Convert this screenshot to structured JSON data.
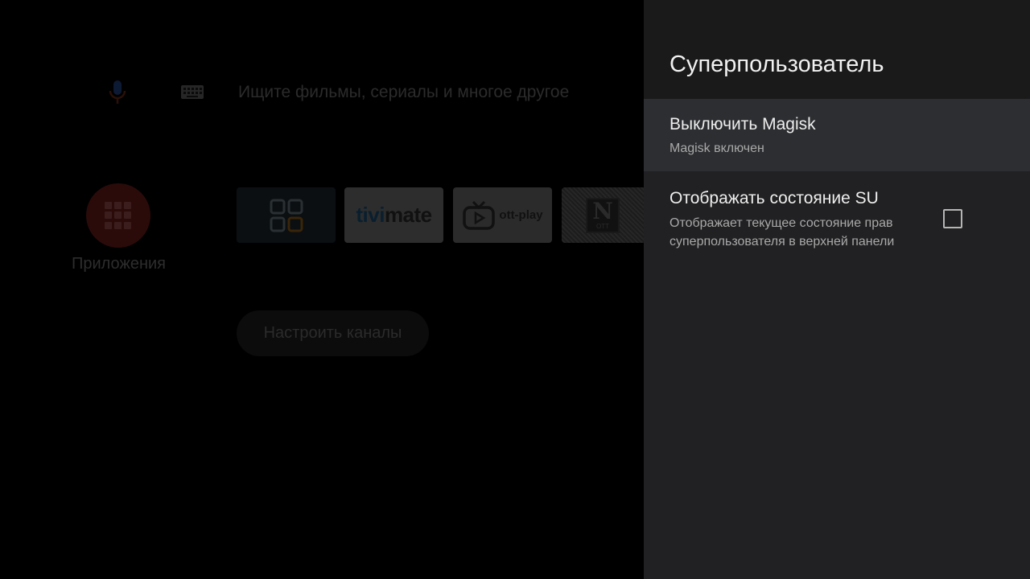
{
  "launcher": {
    "search_placeholder": "Ищите фильмы, сериалы и многое другое",
    "apps_label": "Приложения",
    "tiles": [
      {
        "name": "apps-grid-app"
      },
      {
        "name": "tivimate",
        "label_a": "tivi",
        "label_b": "mate"
      },
      {
        "name": "ott-play",
        "label": "ott-play"
      },
      {
        "name": "ntv-ott",
        "label_main": "N",
        "label_sub": "OTT"
      }
    ],
    "channels_button": "Настроить каналы"
  },
  "panel": {
    "title": "Суперпользователь",
    "items": [
      {
        "title": "Выключить Magisk",
        "summary": "Magisk включен",
        "focused": true
      },
      {
        "title": "Отображать состояние SU",
        "summary": "Отображает текущее состояние прав суперпользователя в верхней панели",
        "checked": false
      }
    ]
  },
  "colors": {
    "panel_bg": "#212123",
    "panel_header_bg": "#1a1a1b",
    "focused_item_bg": "#2d2e31",
    "title_text": "#f1f1f1",
    "summary_text": "#a9a9a9"
  }
}
